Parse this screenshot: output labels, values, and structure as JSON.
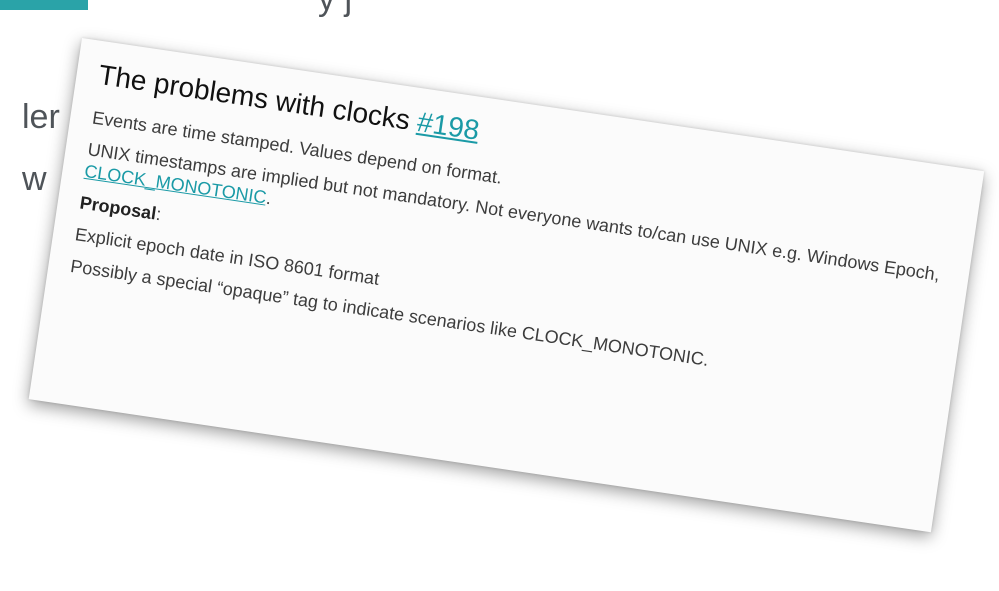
{
  "slide": {
    "partial_line_1": "ler",
    "partial_line_2": "w",
    "top_partial": "y j",
    "accent_color": "#2aa3a8"
  },
  "card": {
    "title": "The problems with clocks",
    "issue_link": "#198",
    "line1": "Events are time stamped. Values depend on format.",
    "line2_text": "UNIX timestamps are implied but not mandatory. Not everyone wants to/can use UNIX e.g. Windows Epoch, ",
    "line2_link": "CLOCK_MONOTONIC",
    "line2_end": ".",
    "proposal_label": "Proposal",
    "proposal_colon": ":",
    "item1": "Explicit epoch date in ISO 8601 format",
    "item2": "Possibly a special “opaque” tag to indicate scenarios like CLOCK_MONOTONIC.",
    "link_color": "#1a9aa6"
  }
}
